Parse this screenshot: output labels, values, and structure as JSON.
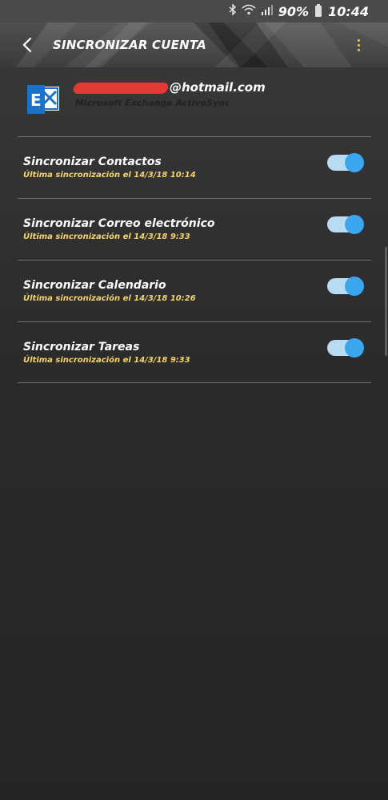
{
  "status_bar": {
    "battery": "90%",
    "time": "10:44",
    "icons": [
      "bluetooth-icon",
      "wifi-icon",
      "signal-icon",
      "battery-icon"
    ]
  },
  "app_bar": {
    "title": "SINCRONIZAR CUENTA",
    "back_icon": "back-arrow-icon",
    "menu_icon": "more-vert-icon"
  },
  "account": {
    "email_visible_suffix": "@hotmail.com",
    "type": "Microsoft Exchange ActiveSync",
    "icon": "exchange-icon"
  },
  "sync_items": [
    {
      "title": "Sincronizar Contactos",
      "subtitle": "Última sincronización el 14/3/18  10:14",
      "enabled": true
    },
    {
      "title": "Sincronizar Correo electrónico",
      "subtitle": "Última sincronización el 14/3/18  9:33",
      "enabled": true
    },
    {
      "title": "Sincronizar Calendario",
      "subtitle": "Última sincronización el 14/3/18  10:26",
      "enabled": true
    },
    {
      "title": "Sincronizar Tareas",
      "subtitle": "Última sincronización el 14/3/18  9:33",
      "enabled": true
    }
  ],
  "colors": {
    "accent_toggle": "#3ba6ee",
    "toggle_track": "#b9dcf4",
    "subtitle": "#f5d36a",
    "menu_dots": "#f4d03f",
    "exchange_blue": "#1a73c9"
  }
}
